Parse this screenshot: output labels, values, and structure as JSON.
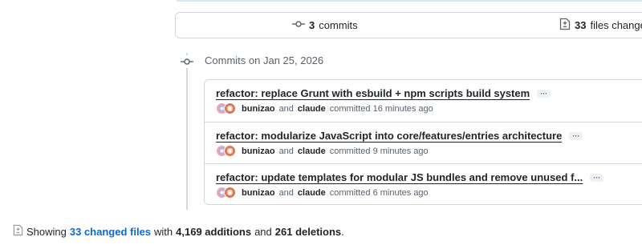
{
  "summary": {
    "commits_count": "3",
    "commits_label": "commits",
    "files_count": "33",
    "files_label": "files changed"
  },
  "timeline": {
    "date_heading": "Commits on Jan 25, 2026"
  },
  "commits": [
    {
      "title": "refactor: replace Grunt with esbuild + npm scripts build system",
      "more": "···",
      "author1": "bunizao",
      "and": "and",
      "author2": "claude",
      "committed": "committed 16 minutes ago"
    },
    {
      "title": "refactor: modularize JavaScript into core/features/entries architecture",
      "more": "···",
      "author1": "bunizao",
      "and": "and",
      "author2": "claude",
      "committed": "committed 9 minutes ago"
    },
    {
      "title": "refactor: update templates for modular JS bundles and remove unused f...",
      "more": "···",
      "author1": "bunizao",
      "and": "and",
      "author2": "claude",
      "committed": "committed 6 minutes ago"
    }
  ],
  "footer": {
    "showing": "Showing",
    "changed_files": "33 changed files",
    "with": "with",
    "additions": "4,169 additions",
    "and": "and",
    "deletions": "261 deletions",
    "period": "."
  },
  "icons": {
    "commit": "git-commit-icon",
    "files": "file-diff-icon"
  },
  "colors": {
    "link": "#0969da",
    "border": "#d1d9e0",
    "muted": "#59636e",
    "text": "#1f2328"
  }
}
